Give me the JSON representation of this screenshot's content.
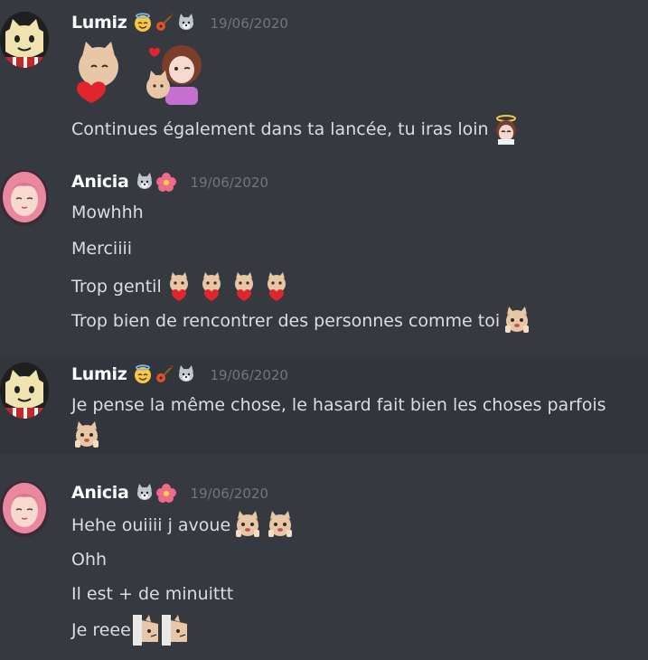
{
  "groups": [
    {
      "username": "Lumiz",
      "timestamp": "19/06/2020",
      "lines": [
        "Continues également dans ta lancée, tu iras loin"
      ]
    },
    {
      "username": "Anicia",
      "timestamp": "19/06/2020",
      "lines": [
        "Mowhhh",
        "Merciiii",
        "Trop gentil",
        "Trop bien de rencontrer des personnes comme toi"
      ]
    },
    {
      "username": "Lumiz",
      "timestamp": "19/06/2020",
      "lines": [
        "Je pense la même chose, le hasard fait bien les choses parfois"
      ]
    },
    {
      "username": "Anicia",
      "timestamp": "19/06/2020",
      "lines": [
        "Hehe ouiiii j avoue",
        "Ohh",
        "Il est + de minuittt",
        "Je reee"
      ]
    }
  ],
  "icons": {
    "lumiz_badges": [
      "angel-face-emoji",
      "guitar-emoji",
      "wolf-emoji"
    ],
    "anicia_badges": [
      "wolf-emoji",
      "hibiscus-emoji"
    ],
    "cat_heart_emote": "cat-heart-emote",
    "peek_emote": "cat-peek-emote"
  },
  "colors": {
    "background": "#36393f",
    "highlight": "#32353b",
    "username": "#ffffff",
    "text": "#dcddde",
    "timestamp": "#72767d"
  }
}
